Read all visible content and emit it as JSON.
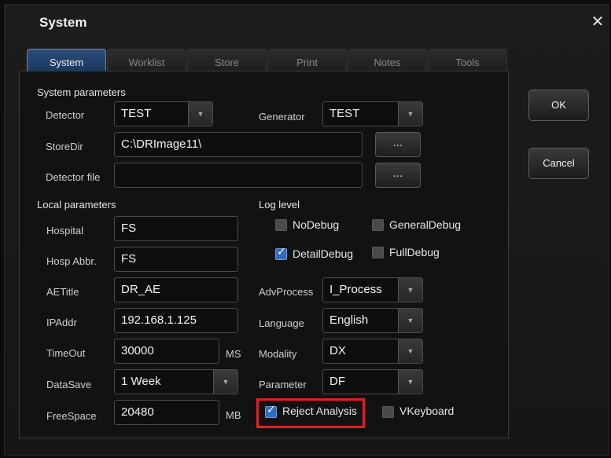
{
  "window": {
    "title": "System",
    "close_icon": "close-icon"
  },
  "tabs": [
    {
      "label": "System",
      "active": true
    },
    {
      "label": "Worklist"
    },
    {
      "label": "Store"
    },
    {
      "label": "Print"
    },
    {
      "label": "Notes"
    },
    {
      "label": "Tools"
    }
  ],
  "system_params": {
    "heading": "System parameters",
    "detector_label": "Detector",
    "detector_value": "TEST",
    "generator_label": "Generator",
    "generator_value": "TEST",
    "storedir_label": "StoreDir",
    "storedir_value": "C:\\DRImage11\\",
    "detector_file_label": "Detector file",
    "detector_file_value": "",
    "browse_label": "..."
  },
  "local_params": {
    "heading": "Local parameters",
    "hospital_label": "Hospital",
    "hospital_value": "FS",
    "hosp_abbr_label": "Hosp Abbr.",
    "hosp_abbr_value": "FS",
    "aetitle_label": "AETitle",
    "aetitle_value": "DR_AE",
    "ipaddr_label": "IPAddr",
    "ipaddr_value": "192.168.1.125",
    "timeout_label": "TimeOut",
    "timeout_value": "30000",
    "timeout_unit": "MS",
    "datasave_label": "DataSave",
    "datasave_value": "1 Week",
    "freespace_label": "FreeSpace",
    "freespace_value": "20480",
    "freespace_unit": "MB"
  },
  "log_level": {
    "heading": "Log level",
    "nodebug": "NoDebug",
    "generaldebug": "GeneralDebug",
    "detaildebug": "DetailDebug",
    "fulldebug": "FullDebug"
  },
  "options": {
    "advprocess_label": "AdvProcess",
    "advprocess_value": "I_Process",
    "language_label": "Language",
    "language_value": "English",
    "modality_label": "Modality",
    "modality_value": "DX",
    "parameter_label": "Parameter",
    "parameter_value": "DF",
    "reject_analysis": "Reject Analysis",
    "vkeyboard": "VKeyboard"
  },
  "buttons": {
    "ok": "OK",
    "cancel": "Cancel"
  },
  "colors": {
    "accent": "#2f6bc1",
    "highlight": "#e02020",
    "tab_active": "#2b4d7a"
  }
}
